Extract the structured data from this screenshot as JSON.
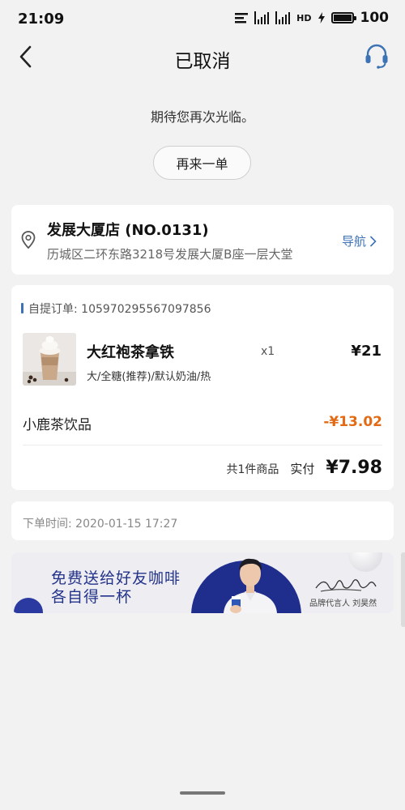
{
  "status_bar": {
    "time": "21:09",
    "network_label": "HD",
    "battery": "100",
    "battery_level": 1.0
  },
  "header": {
    "title": "已取消",
    "back_icon": "chevron-left-icon",
    "support_icon": "headset-icon",
    "accent_color": "#3d72b4"
  },
  "welcome_text": "期待您再次光临。",
  "reorder_button": "再来一单",
  "store": {
    "name": "发展大厦店 (NO.0131)",
    "address": "历城区二环东路3218号发展大厦B座一层大堂",
    "navigate_label": "导航"
  },
  "order": {
    "number_text": "自提订单: 105970295567097856",
    "item": {
      "name": "大红袍茶拿铁",
      "spec": "大/全糖(推荐)/默认奶油/热",
      "qty": "x1",
      "price": "¥21"
    },
    "discount": {
      "name": "小鹿茶饮品",
      "amount": "-¥13.02",
      "color": "#e36a14"
    },
    "total": {
      "count": "共1件商品",
      "label": "实付",
      "amount": "¥7.98"
    }
  },
  "order_time": "下单时间:  2020-01-15 17:27",
  "banner": {
    "line1": "免费送给好友咖啡",
    "line2": "各自得一杯",
    "caption": "品牌代言人 刘昊然",
    "brand_color": "#1f2e8c"
  }
}
